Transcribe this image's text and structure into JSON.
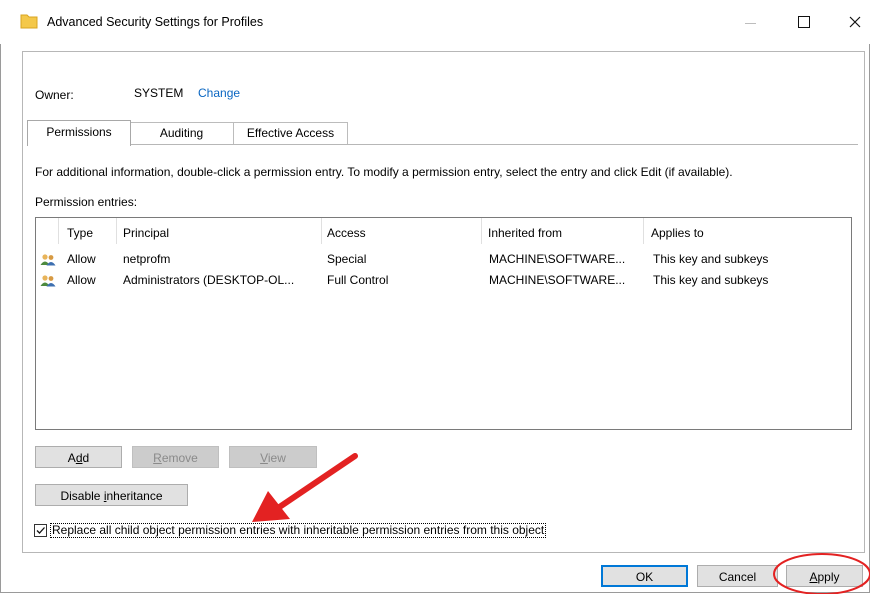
{
  "window": {
    "title": "Advanced Security Settings for Profiles"
  },
  "owner": {
    "label": "Owner:",
    "value": "SYSTEM",
    "change_link": "Change"
  },
  "tabs": [
    {
      "label": "Permissions",
      "active": true
    },
    {
      "label": "Auditing",
      "active": false
    },
    {
      "label": "Effective Access",
      "active": false
    }
  ],
  "info_text": "For additional information, double-click a permission entry. To modify a permission entry, select the entry and click Edit (if available).",
  "entries_label": "Permission entries:",
  "table": {
    "columns": [
      "Type",
      "Principal",
      "Access",
      "Inherited from",
      "Applies to"
    ],
    "rows": [
      {
        "type": "Allow",
        "principal": "netprofm",
        "access": "Special",
        "inherited_from": "MACHINE\\SOFTWARE...",
        "applies_to": "This key and subkeys",
        "icon": "users-icon"
      },
      {
        "type": "Allow",
        "principal": "Administrators (DESKTOP-OL...",
        "access": "Full Control",
        "inherited_from": "MACHINE\\SOFTWARE...",
        "applies_to": "This key and subkeys",
        "icon": "users-icon"
      }
    ]
  },
  "buttons": {
    "add": {
      "pre": "A",
      "accel": "d",
      "post": "d"
    },
    "remove": {
      "pre": "",
      "accel": "R",
      "post": "emove"
    },
    "view": {
      "pre": "",
      "accel": "V",
      "post": "iew"
    },
    "disable_inheritance": {
      "pre": "Disable ",
      "accel": "i",
      "post": "nheritance"
    },
    "ok": "OK",
    "cancel": "Cancel",
    "apply": {
      "pre": "",
      "accel": "A",
      "post": "pply"
    }
  },
  "replace_checkbox": {
    "label": "Replace all child object permission entries with inheritable permission entries from this object",
    "checked": true
  },
  "colors": {
    "annotation_red": "#e32222",
    "link_blue": "#0a66c2",
    "focus_blue": "#0078d7"
  }
}
